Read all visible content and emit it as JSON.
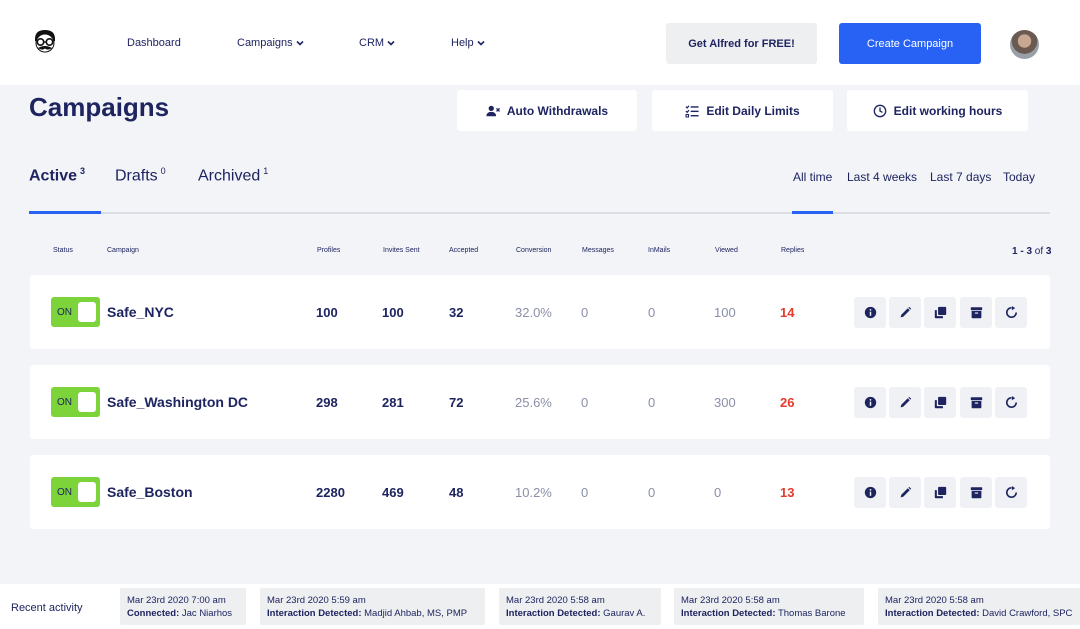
{
  "nav": {
    "items": [
      {
        "label": "Dashboard",
        "dropdown": false
      },
      {
        "label": "Campaigns",
        "dropdown": true
      },
      {
        "label": "CRM",
        "dropdown": true
      },
      {
        "label": "Help",
        "dropdown": true
      }
    ],
    "get_alfred_label": "Get Alfred for FREE!",
    "create_campaign_label": "Create Campaign"
  },
  "page": {
    "title": "Campaigns",
    "toolbar": {
      "auto_withdrawals": "Auto Withdrawals",
      "edit_daily_limits": "Edit Daily Limits",
      "edit_working_hours": "Edit working hours"
    }
  },
  "tabs": [
    {
      "label": "Active",
      "count": "3",
      "active": true
    },
    {
      "label": "Drafts",
      "count": "0",
      "active": false
    },
    {
      "label": "Archived",
      "count": "1",
      "active": false
    }
  ],
  "time_filters": [
    {
      "label": "All time",
      "active": true
    },
    {
      "label": "Last 4 weeks",
      "active": false
    },
    {
      "label": "Last 7 days",
      "active": false
    },
    {
      "label": "Today",
      "active": false
    }
  ],
  "table": {
    "columns": [
      "Status",
      "Campaign",
      "Profiles",
      "Invites Sent",
      "Accepted",
      "Conversion",
      "Messages",
      "InMails",
      "Viewed",
      "Replies"
    ],
    "pager": {
      "range": "1 - 3",
      "of": "of",
      "total": "3"
    },
    "rows": [
      {
        "status": "ON",
        "campaign": "Safe_NYC",
        "profiles": "100",
        "invites_sent": "100",
        "accepted": "32",
        "conversion": "32.0%",
        "messages": "0",
        "inmails": "0",
        "viewed": "100",
        "replies": "14"
      },
      {
        "status": "ON",
        "campaign": "Safe_Washington DC",
        "profiles": "298",
        "invites_sent": "281",
        "accepted": "72",
        "conversion": "25.6%",
        "messages": "0",
        "inmails": "0",
        "viewed": "300",
        "replies": "26"
      },
      {
        "status": "ON",
        "campaign": "Safe_Boston",
        "profiles": "2280",
        "invites_sent": "469",
        "accepted": "48",
        "conversion": "10.2%",
        "messages": "0",
        "inmails": "0",
        "viewed": "0",
        "replies": "13"
      }
    ],
    "row_actions": [
      "info-icon",
      "pencil-icon",
      "copy-icon",
      "archive-icon",
      "refresh-icon"
    ]
  },
  "activity": {
    "title": "Recent activity",
    "items": [
      {
        "time": "Mar 23rd 2020 7:00 am",
        "type": "Connected:",
        "name": "Jac Niarhos"
      },
      {
        "time": "Mar 23rd 2020 5:59 am",
        "type": "Interaction Detected:",
        "name": "Madjid Ahbab, MS, PMP"
      },
      {
        "time": "Mar 23rd 2020 5:58 am",
        "type": "Interaction Detected:",
        "name": "Gaurav A."
      },
      {
        "time": "Mar 23rd 2020 5:58 am",
        "type": "Interaction Detected:",
        "name": "Thomas Barone"
      },
      {
        "time": "Mar 23rd 2020 5:58 am",
        "type": "Interaction Detected:",
        "name": "David Crawford, SPC"
      }
    ]
  },
  "colors": {
    "brand_blue": "#2762f5",
    "navy_text": "#1e2460",
    "toggle_on": "#7cd33a",
    "replies_red": "#e53a2c"
  }
}
